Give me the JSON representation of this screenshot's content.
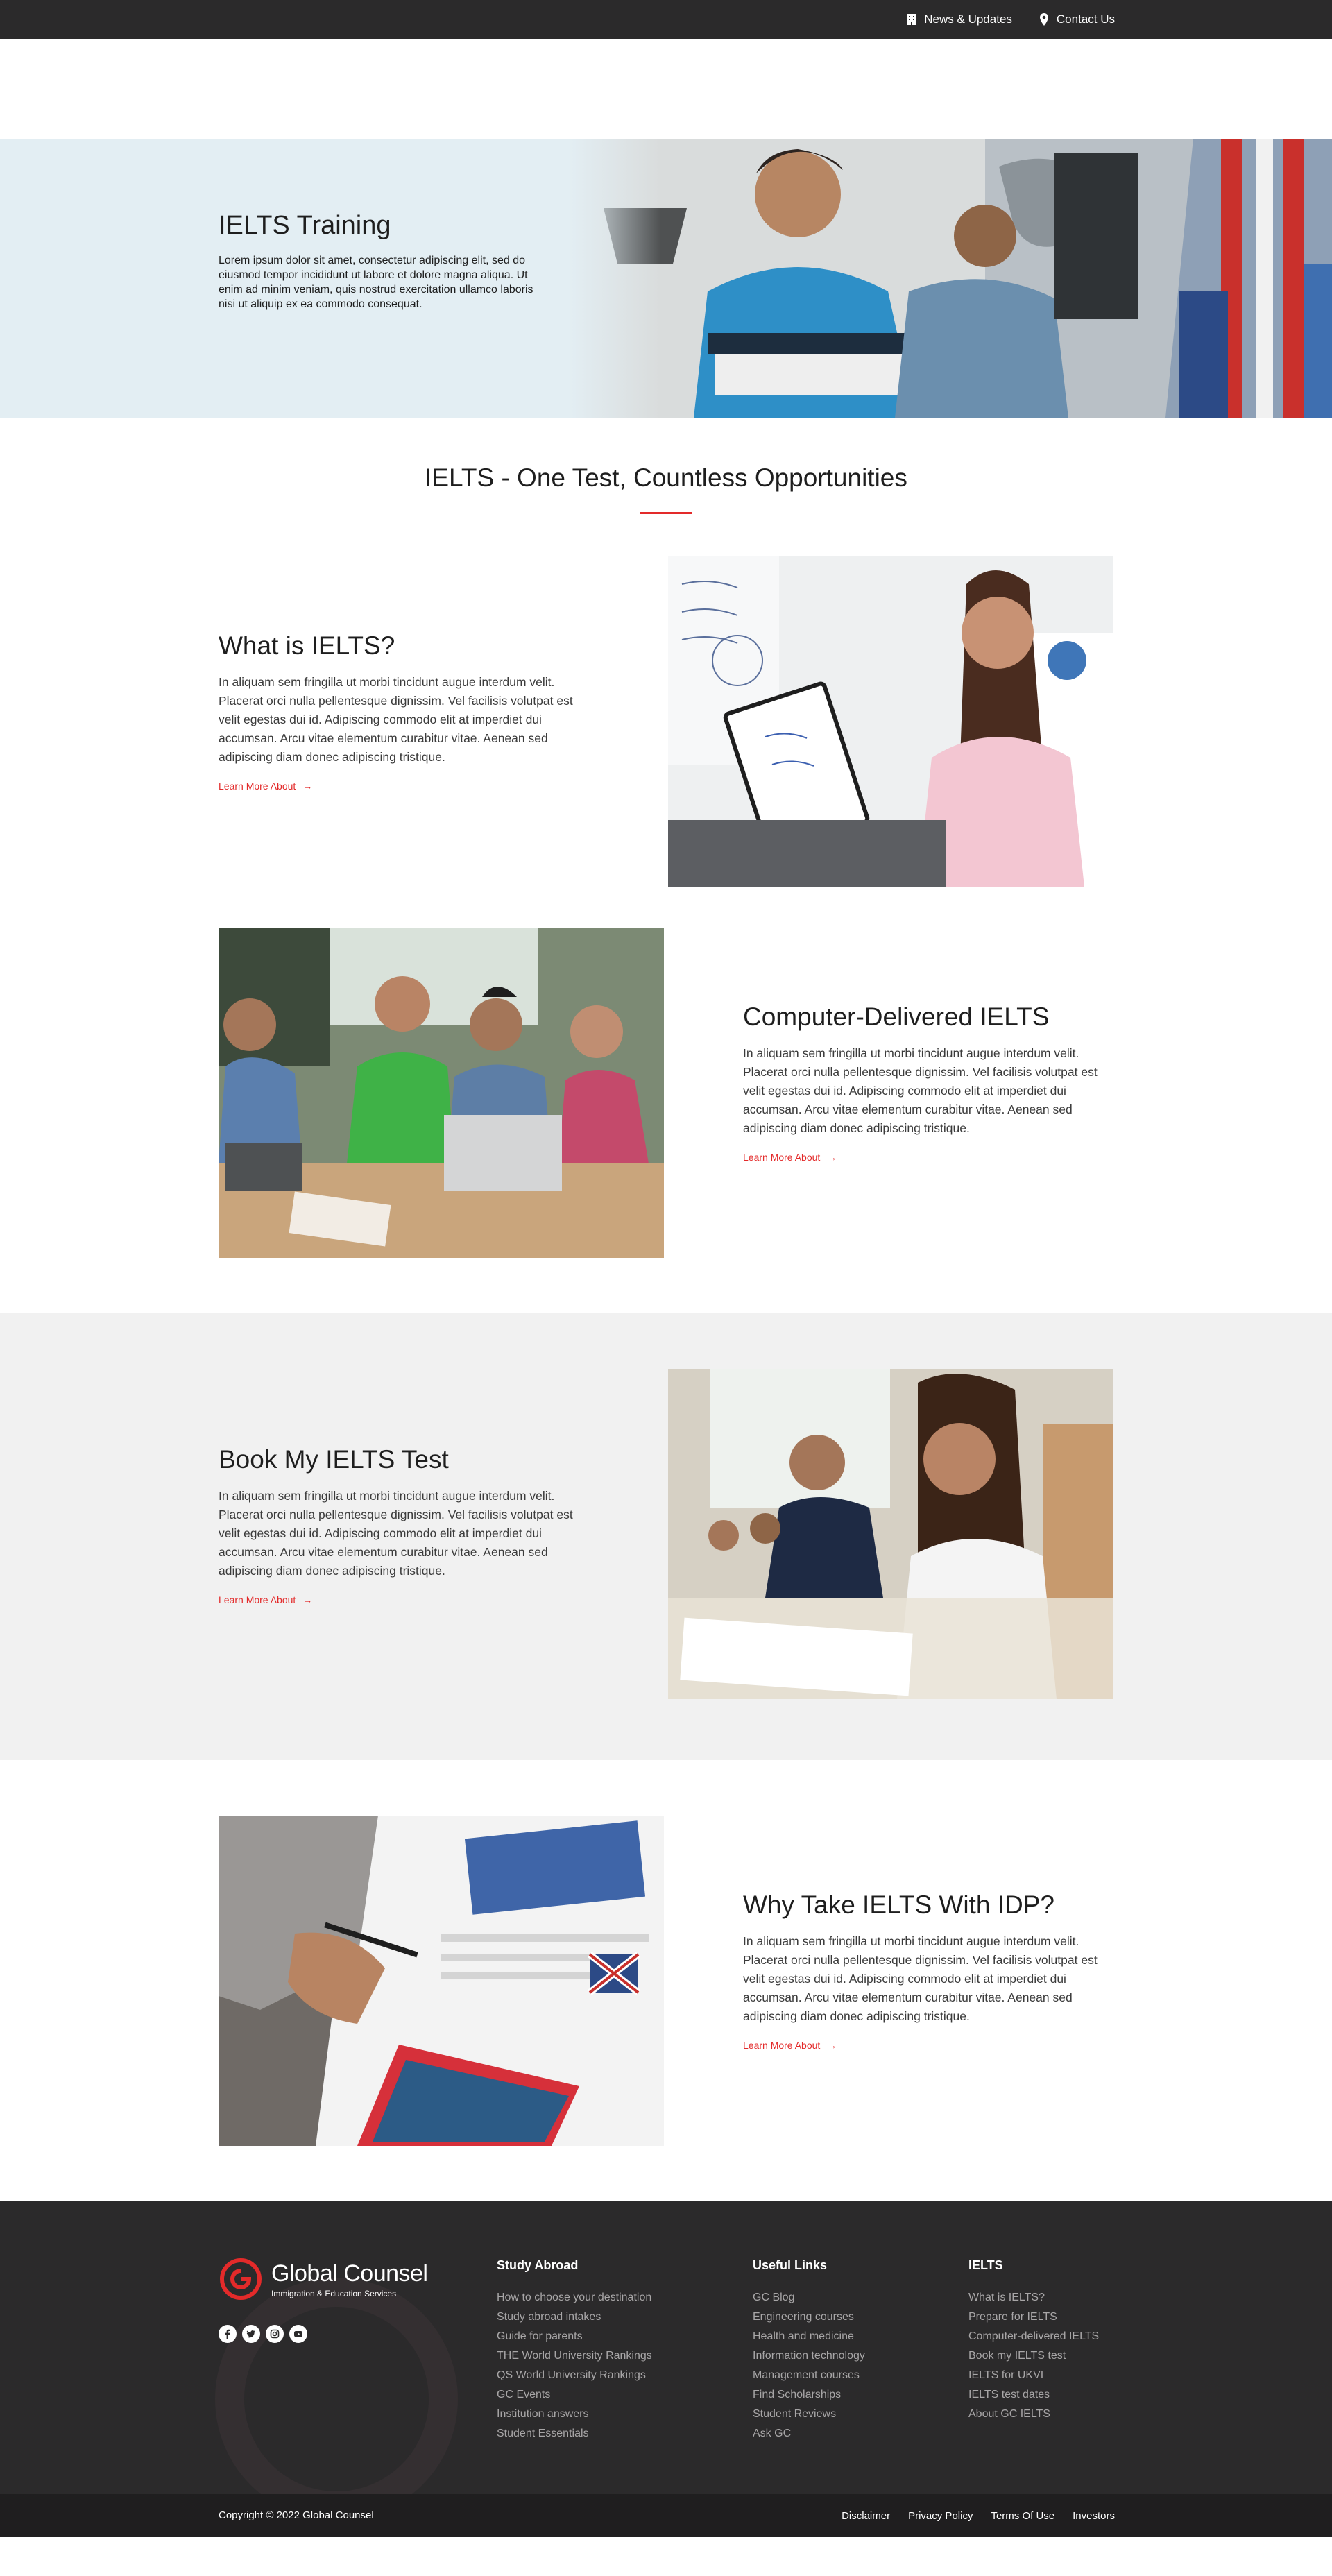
{
  "topbar": {
    "news_label": "News & Updates",
    "contact_label": "Contact Us"
  },
  "hero": {
    "title": "IELTS Training",
    "description": "Lorem ipsum dolor sit amet, consectetur adipiscing elit, sed do eiusmod tempor incididunt ut labore et dolore magna aliqua. Ut enim ad minim veniam, quis nostrud exercitation ullamco laboris nisi ut aliquip ex ea commodo consequat."
  },
  "main": {
    "heading": "IELTS - One Test, Countless Opportunities",
    "features": [
      {
        "title": "What is IELTS?",
        "description": "In aliquam sem fringilla ut morbi tincidunt augue interdum velit. Placerat orci nulla pellentesque dignissim. Vel facilisis volutpat est velit egestas dui id. Adipiscing commodo elit at imperdiet dui accumsan. Arcu vitae elementum curabitur vitae. Aenean sed adipiscing diam donec adipiscing tristique.",
        "link": "Learn More About"
      },
      {
        "title": "Computer-Delivered IELTS",
        "description": "In aliquam sem fringilla ut morbi tincidunt augue interdum velit. Placerat orci nulla pellentesque dignissim. Vel facilisis volutpat est velit egestas dui id. Adipiscing commodo elit at imperdiet dui accumsan. Arcu vitae elementum curabitur vitae. Aenean sed adipiscing diam donec adipiscing tristique.",
        "link": "Learn More About"
      },
      {
        "title": "Book My IELTS Test",
        "description": "In aliquam sem fringilla ut morbi tincidunt augue interdum velit. Placerat orci nulla pellentesque dignissim. Vel facilisis volutpat est velit egestas dui id. Adipiscing commodo elit at imperdiet dui accumsan. Arcu vitae elementum curabitur vitae. Aenean sed adipiscing diam donec adipiscing tristique.",
        "link": "Learn More About"
      },
      {
        "title": "Why Take IELTS With IDP?",
        "description": "In aliquam sem fringilla ut morbi tincidunt augue interdum velit. Placerat orci nulla pellentesque dignissim. Vel facilisis volutpat est velit egestas dui id. Adipiscing commodo elit at imperdiet dui accumsan. Arcu vitae elementum curabitur vitae. Aenean sed adipiscing diam donec adipiscing tristique.",
        "link": "Learn More About"
      }
    ]
  },
  "footer": {
    "brand_name": "Global Counsel",
    "brand_tagline": "Immigration & Education Services",
    "socials": [
      "facebook-icon",
      "twitter-icon",
      "instagram-icon",
      "youtube-icon"
    ],
    "columns": [
      {
        "title": "Study Abroad",
        "items": [
          "How to choose your destination",
          "Study abroad intakes",
          "Guide for parents",
          "THE World University Rankings",
          "QS World University Rankings",
          "GC Events",
          "Institution answers",
          "Student Essentials"
        ]
      },
      {
        "title": "Useful Links",
        "items": [
          "GC Blog",
          "Engineering courses",
          "Health and medicine",
          "Information technology",
          "Management courses",
          "Find Scholarships",
          "Student Reviews",
          "Ask GC"
        ]
      },
      {
        "title": "IELTS",
        "items": [
          "What is IELTS?",
          "Prepare for IELTS",
          "Computer-delivered IELTS",
          "Book my IELTS test",
          "IELTS for UKVI",
          "IELTS test dates",
          "About GC IELTS"
        ]
      }
    ],
    "copyright": "Copyright © 2022 Global Counsel",
    "legal": [
      "Disclaimer",
      "Privacy Policy",
      "Terms Of Use",
      "Investors"
    ]
  },
  "colors": {
    "accent": "#e32a2a",
    "dark": "#2b2a2b",
    "hero_bg": "#e3eef3",
    "band_bg": "#f1f1f1"
  }
}
